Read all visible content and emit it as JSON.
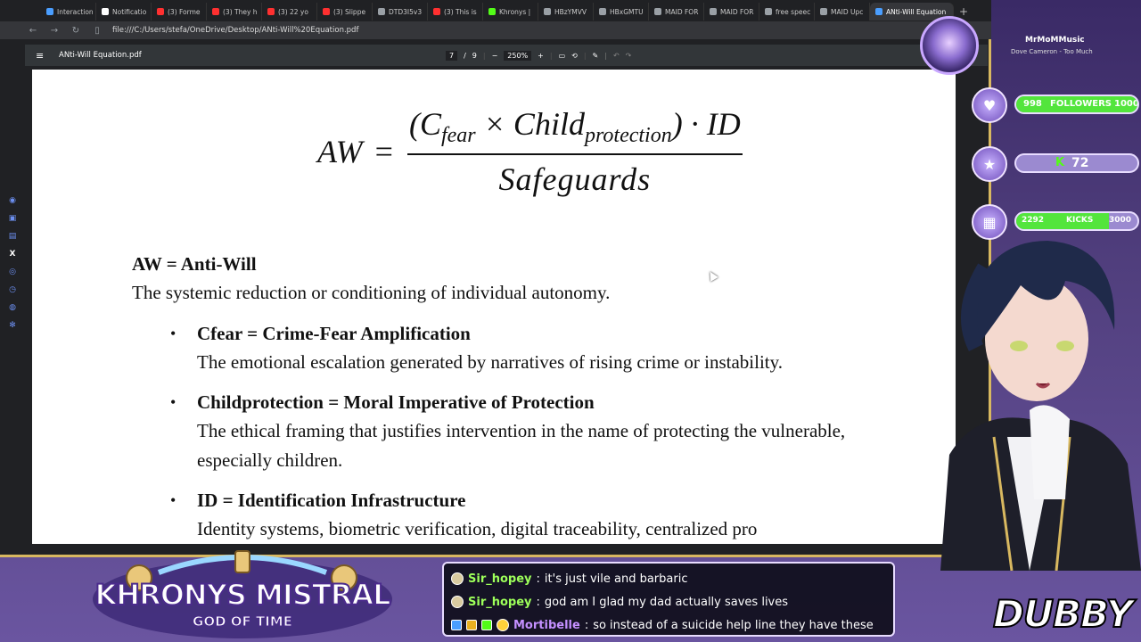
{
  "browser": {
    "tabs": [
      {
        "label": "Interaction",
        "color": "#4a9eff"
      },
      {
        "label": "Notificatio",
        "color": "#ffffff"
      },
      {
        "label": "(3) Forme",
        "color": "#ff3030"
      },
      {
        "label": "(3) They h",
        "color": "#ff3030"
      },
      {
        "label": "(3) 22 yo",
        "color": "#ff3030"
      },
      {
        "label": "(3) Slippe",
        "color": "#ff3030"
      },
      {
        "label": "DTD3I5v3",
        "color": "#9aa0a6"
      },
      {
        "label": "(3) This is",
        "color": "#ff3030"
      },
      {
        "label": "Khronys |",
        "color": "#53fc18"
      },
      {
        "label": "HBzYMVV",
        "color": "#9aa0a6"
      },
      {
        "label": "HBxGMTU",
        "color": "#9aa0a6"
      },
      {
        "label": "MAID FOR",
        "color": "#9aa0a6"
      },
      {
        "label": "MAID FOR",
        "color": "#9aa0a6"
      },
      {
        "label": "free speec",
        "color": "#9aa0a6"
      },
      {
        "label": "MAID Upc",
        "color": "#9aa0a6"
      },
      {
        "label": "ANti-Will Equation",
        "color": "#4a9eff",
        "active": true
      }
    ],
    "url": "file:///C:/Users/stefa/OneDrive/Desktop/ANti-Will%20Equation.pdf"
  },
  "pdf": {
    "title": "ANti-Will Equation.pdf",
    "page_current": "7",
    "page_sep": "/",
    "page_total": "9",
    "zoom": "250%",
    "formula": {
      "lhs": "AW",
      "eq": "=",
      "num_open": "(C",
      "num_sub1": "fear",
      "num_times": " × Child",
      "num_sub2": "protection",
      "num_close": ") · ID",
      "den": "Safeguards"
    },
    "aw_heading": "AW = Anti-Will",
    "aw_text": "The systemic reduction or conditioning of individual autonomy.",
    "items": [
      {
        "heading": "Cfear = Crime-Fear Amplification",
        "text1": "The emotional escalation generated by narratives of rising crime or instability.",
        "text2": ""
      },
      {
        "heading": "Childprotection = Moral Imperative of Protection",
        "text1": "The ethical framing that justifies intervention in the name of protecting the vulnerable,",
        "text2": "especially children."
      },
      {
        "heading": "ID = Identification Infrastructure",
        "text1": "Identity systems, biometric verification, digital traceability, centralized pro",
        "text2": ""
      }
    ]
  },
  "overlay": {
    "now_playing_title": "MrMoMMusic",
    "now_playing_artist": "Dove Cameron - Too Much",
    "followers_current": "998",
    "followers_label": "FOLLOWERS",
    "followers_goal": "1000",
    "followers_progress": 0.998,
    "kick_count": "72",
    "kicks_current": "2292",
    "kicks_label": "KICKS",
    "kicks_goal": "3000",
    "kicks_progress": 0.764,
    "banner_name": "KHRONYS MISTRAL",
    "banner_sub": "GOD OF TIME",
    "watermark": "DUBBY",
    "chat": [
      {
        "user": "Sir_hopey",
        "user_color": "#9dff5a",
        "text": "it's just vile and barbaric"
      },
      {
        "user": "Sir_hopey",
        "user_color": "#9dff5a",
        "text": "god am I glad my dad actually saves lives"
      },
      {
        "user": "Mortibelle",
        "user_color": "#c490ff",
        "text": "so instead of a suicide help line they have these"
      }
    ]
  }
}
